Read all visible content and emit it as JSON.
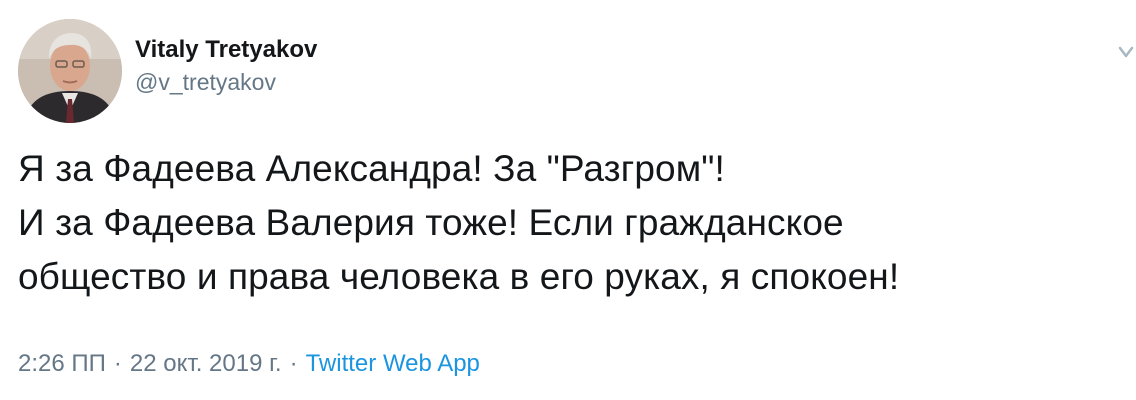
{
  "author": {
    "display_name": "Vitaly Tretyakov",
    "handle": "@v_tretyakov"
  },
  "tweet": {
    "text": "Я за Фадеева Александра! За \"Разгром\"!\nИ за Фадеева Валерия тоже! Если гражданское\nобщество и права человека в его руках, я спокоен!"
  },
  "meta": {
    "time": "2:26 ПП",
    "separator": "·",
    "date": "22 окт. 2019 г.",
    "source": "Twitter Web App"
  },
  "colors": {
    "text": "#14171a",
    "secondary": "#657786",
    "link": "#1b95e0"
  },
  "icons": {
    "menu": "chevron-down-icon"
  }
}
